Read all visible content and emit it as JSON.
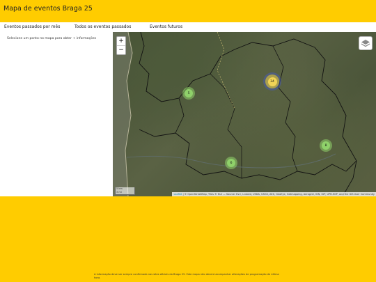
{
  "header": {
    "title": "Mapa de eventos Braga 25"
  },
  "tabs": [
    {
      "label": "Eventos passados por mês"
    },
    {
      "label": "Todos os eventos passados"
    },
    {
      "label": "Eventos futuros"
    }
  ],
  "sidebar": {
    "hint": "Selecione um ponto no mapa para obter + informações"
  },
  "map": {
    "zoom_in": "+",
    "zoom_out": "−",
    "layers_icon": "layers-icon",
    "clusters": [
      {
        "count": "5",
        "color": "#8fd16a"
      },
      {
        "count": "34",
        "color": "#f1d357"
      },
      {
        "count": "8",
        "color": "#8fd16a"
      },
      {
        "count": "6",
        "color": "#8fd16a"
      }
    ],
    "scale": {
      "top": "5 km",
      "bottom": "3 mi"
    },
    "attribution": {
      "leaflet": "Leaflet",
      "text": " | © OpenStreetMap, Tiles © Esri — Source: Esri, i-cubed, USDA, USGS, AEX, GeoEye, Getmapping, Aerogrid, IGN, IGP, UPR-EGP, and the GIS User Community"
    }
  },
  "footer": {
    "text": "A informação deve ser sempre confirmada nas sites oficiais da Braga 25. Este mapa não deverá acompanhar alterações de programação de última hora."
  }
}
